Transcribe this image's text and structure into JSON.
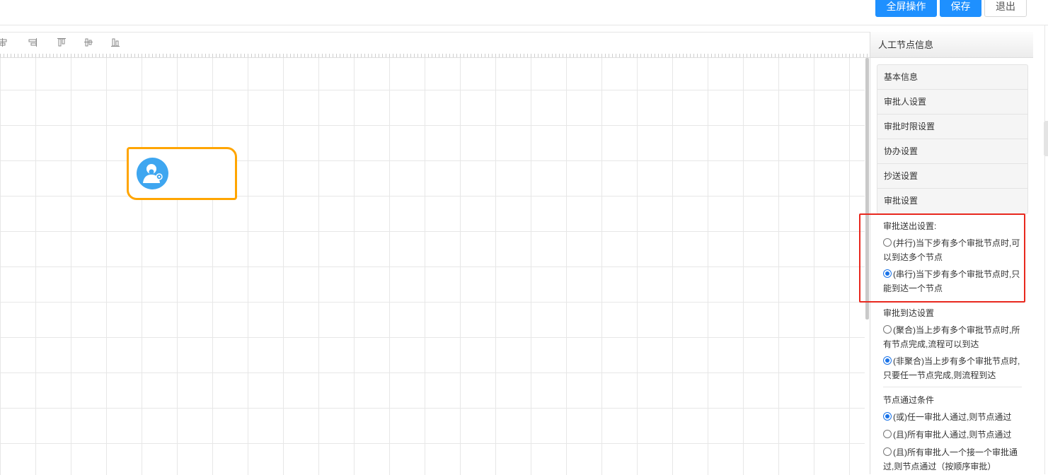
{
  "header": {
    "buttons": {
      "fullscreen": "全屏操作",
      "save": "保存",
      "exit": "退出"
    }
  },
  "toolbar": {
    "tools": [
      "align-center-icon",
      "align-right-icon",
      "align-top-icon",
      "align-middle-icon",
      "align-bottom-icon"
    ]
  },
  "canvas": {
    "node": {
      "type": "manual-node",
      "icon": "user-icon",
      "border_color": "#ffa500"
    }
  },
  "panel": {
    "title": "人工节点信息",
    "menu": [
      "基本信息",
      "审批人设置",
      "审批时限设置",
      "协办设置",
      "抄送设置",
      "审批设置"
    ],
    "send_out": {
      "title": "审批送出设置:",
      "options": [
        {
          "label": "(并行)当下步有多个审批节点时,可以到达多个节点",
          "checked": false
        },
        {
          "label": "(串行)当下步有多个审批节点时,只能到达一个节点",
          "checked": true
        }
      ]
    },
    "arrive": {
      "title": "审批到达设置",
      "options": [
        {
          "label": "(聚合)当上步有多个审批节点时,所有节点完成,流程可以到达",
          "checked": false
        },
        {
          "label": "(非聚合)当上步有多个审批节点时,只要任一节点完成,则流程到达",
          "checked": true
        }
      ]
    },
    "pass": {
      "title": "节点通过条件",
      "options": [
        {
          "label": "(或)任一审批人通过,则节点通过",
          "checked": true
        },
        {
          "label": "(且)所有审批人通过,则节点通过",
          "checked": false
        },
        {
          "label": "(且)所有审批人一个接一个审批通过,则节点通过（按顺序审批）",
          "checked": false
        }
      ]
    }
  },
  "colors": {
    "primary": "#1e90ff",
    "highlight": "#e8281e",
    "node_border": "#ffa500",
    "avatar": "#3ea6f0"
  }
}
